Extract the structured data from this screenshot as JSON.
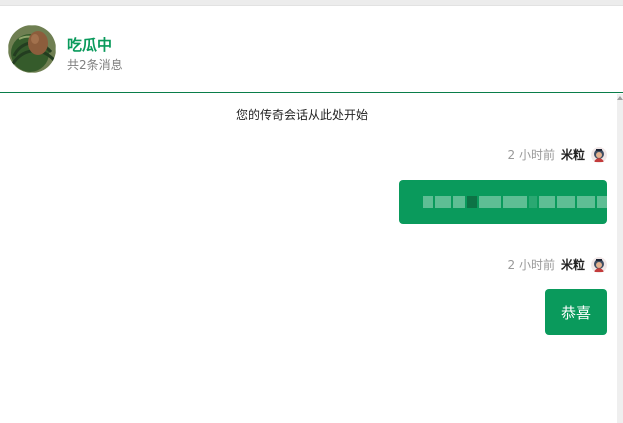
{
  "header": {
    "title": "吃瓜中",
    "subtitle": "共2条消息",
    "avatar_icon": "watermelon-photo-avatar"
  },
  "chat": {
    "start_notice": "您的传奇会话从此处开始",
    "messages": [
      {
        "time": "2 小时前",
        "user": "米粒",
        "text": "",
        "blurred": true
      },
      {
        "time": "2 小时前",
        "user": "米粒",
        "text": "恭喜",
        "blurred": false
      }
    ]
  },
  "colors": {
    "accent": "#0a9a5c",
    "header_border": "#0a7d4a",
    "muted_text": "#999999"
  }
}
